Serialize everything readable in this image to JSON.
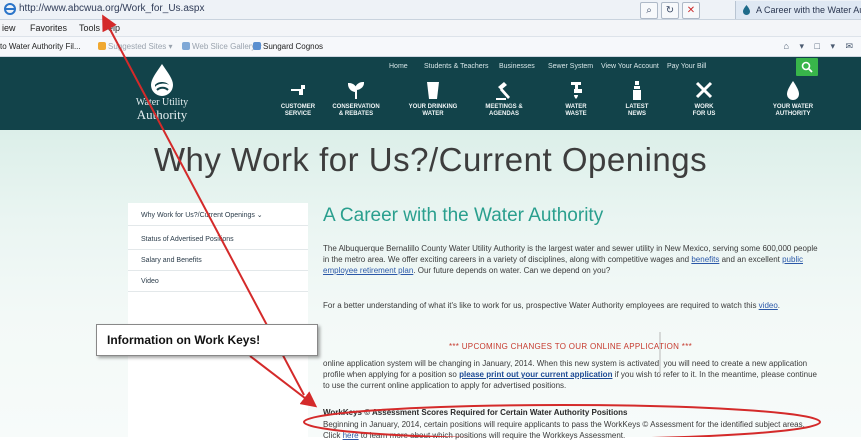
{
  "browser": {
    "url": "http://www.abcwua.org/Work_for_Us.aspx",
    "tab_title": "A Career with the Water Aut..."
  },
  "menu": [
    "iew",
    "Favorites",
    "Tools",
    "elp"
  ],
  "favorites": {
    "items": [
      {
        "label": "to Water Authority Fil...",
        "faded": false
      },
      {
        "label": "Suggested Sites ▾",
        "faded": true
      },
      {
        "label": "Web Slice Gallery ▾",
        "faded": true
      },
      {
        "label": "Sungard Cognos",
        "faded": false
      }
    ]
  },
  "site": {
    "logo_line1": "Water Utility",
    "logo_line2": "Authority",
    "top_nav": [
      "Home",
      "Students & Teachers",
      "Businesses",
      "Sewer System",
      "View Your Account",
      "Pay Your Bill"
    ],
    "main_nav": [
      {
        "line1": "CUSTOMER",
        "line2": "SERVICE",
        "icon": "faucet-icon"
      },
      {
        "line1": "CONSERVATION",
        "line2": "& REBATES",
        "icon": "plant-icon"
      },
      {
        "line1": "YOUR DRINKING",
        "line2": "WATER",
        "icon": "glass-icon"
      },
      {
        "line1": "MEETINGS &",
        "line2": "AGENDAS",
        "icon": "gavel-icon"
      },
      {
        "line1": "WATER",
        "line2": "WASTE",
        "icon": "tap-icon"
      },
      {
        "line1": "LATEST",
        "line2": "NEWS",
        "icon": "news-icon"
      },
      {
        "line1": "WORK",
        "line2": "FOR US",
        "icon": "tools-icon"
      },
      {
        "line1": "YOUR WATER",
        "line2": "AUTHORITY",
        "icon": "drop-icon"
      }
    ]
  },
  "page": {
    "title": "Why Work for Us?/Current Openings",
    "sidebar": [
      "Why Work for Us?/Current Openings ⌄",
      "Status of Advertised Positions",
      "Salary and Benefits",
      "Video"
    ],
    "heading": "A Career with the Water Authority",
    "p1_a": "The Albuquerque Bernalillo County Water Utility Authority is the largest water and sewer utility in New Mexico, serving some 600,000 people in the metro area.  We offer exciting careers in a variety of disciplines, along with competitive wages and ",
    "p1_link1": "benefits",
    "p1_b": " and an excellent ",
    "p1_link2": "public employee retirement plan",
    "p1_c": ". Our future depends on water. Can we depend on you?",
    "p2_a": "For a better understanding of what it's like to work for us, prospective Water Authority employees are required to watch this ",
    "p2_link": "video",
    "p2_b": ".",
    "notice": "*** UPCOMING CHANGES TO OUR ONLINE APPLICATION ***",
    "p3_a": "online application system will be changing in January, 2014. When this new system is activated, you will need to create a new application profile when applying for a position so ",
    "p3_link": "please print out your current application",
    "p3_b": " if you wish to refer to it. In the meantime, please continue to use the current online application to apply for advertised positions.",
    "wk_heading": "WorkKeys © Assessment Scores Required for Certain Water Authority Positions",
    "p4_a": "Beginning in January, 2014, certain positions will require applicants to pass the WorkKeys © Assessment for the identified subject areas. Click ",
    "p4_link": "here",
    "p4_b": " to learn more about which positions will require the Workkeys Assessment."
  },
  "annotation": {
    "callout": "Information on Work Keys!",
    "color": "#d42a2a"
  }
}
